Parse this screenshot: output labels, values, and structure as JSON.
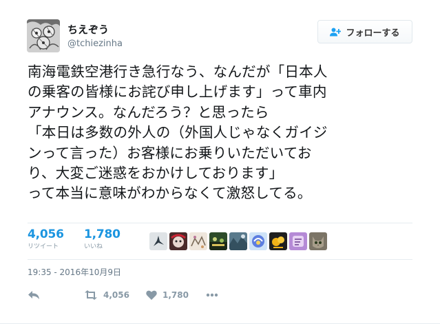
{
  "user": {
    "display_name": "ちえぞう",
    "screen_name": "@tchiezinha",
    "avatar_icon": "avatar-illustration"
  },
  "follow_button": {
    "icon": "person-plus-icon",
    "label": "フォローする"
  },
  "tweet": {
    "lines": [
      "南海電鉄空港行き急行なう、なんだが「日本人",
      "の乗客の皆様にお詫び申し上げます」って車内",
      "アナウンス。なんだろう？と思ったら",
      "「本日は多数の外人の（外国人じゃなくガイジ",
      "ンって言った）お客様にお乗りいただいてお",
      "り、大変ご迷惑をおかけしております」",
      "って本当に意味がわからなくて激怒してる。"
    ]
  },
  "stats": {
    "retweets": {
      "value": "4,056",
      "label": "リツイート"
    },
    "likes": {
      "value": "1,780",
      "label": "いいね"
    }
  },
  "likers_count_shown": 9,
  "timestamp": "19:35 - 2016年10月9日",
  "actions": {
    "reply_icon": "reply-icon",
    "retweet_icon": "retweet-icon",
    "retweet_count": "4,056",
    "like_icon": "heart-icon",
    "like_count": "1,780",
    "more_icon": "more-dots-icon"
  },
  "colors": {
    "accent": "#1b95e0",
    "muted": "#8899a6",
    "text": "#14171a",
    "divider": "#e6ecf0"
  }
}
